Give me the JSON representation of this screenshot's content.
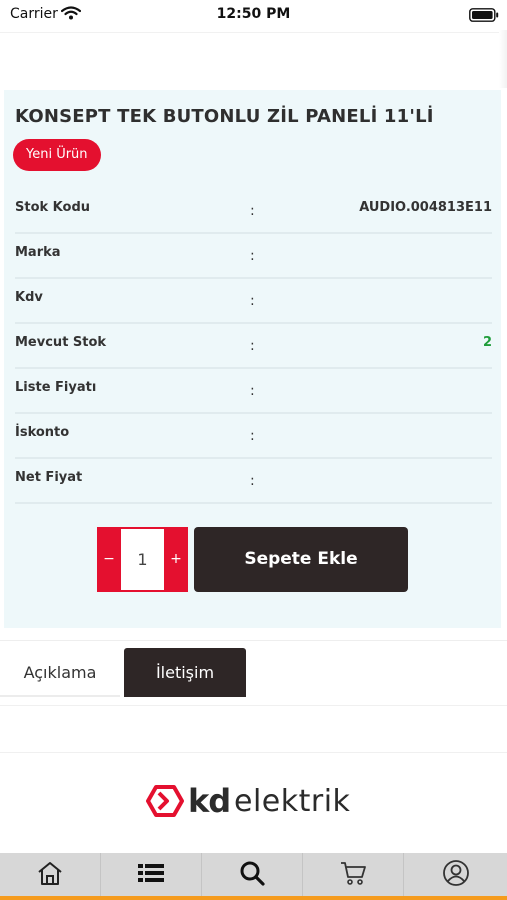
{
  "status_bar": {
    "carrier": "Carrier",
    "time": "12:50 PM"
  },
  "product": {
    "title": "KONSEPT TEK BUTONLU ZİL PANELİ 11'Lİ",
    "badge": "Yeni Ürün",
    "specs": [
      {
        "label": "Stok Kodu",
        "colon": ":",
        "value": ""
      },
      {
        "label": "Marka",
        "colon": ":",
        "value": ""
      },
      {
        "label": "Kdv",
        "colon": ":",
        "value": ""
      },
      {
        "label": "Mevcut Stok",
        "colon": ":",
        "value": ""
      },
      {
        "label": "Liste Fiyatı",
        "colon": ":",
        "value": ""
      },
      {
        "label": "İskonto",
        "colon": ":",
        "value": ""
      },
      {
        "label": "Net Fiyat",
        "colon": ":",
        "value": ""
      }
    ],
    "stock_code_value": "AUDIO.004813E11",
    "stock_qty_value": "2"
  },
  "cart": {
    "minus": "−",
    "quantity": "1",
    "plus": "+",
    "add_label": "Sepete Ekle"
  },
  "tabs": [
    {
      "label": "Açıklama",
      "active": false
    },
    {
      "label": "İletişim",
      "active": true
    }
  ],
  "logo": {
    "kd": "kd",
    "elektrik": "elektrik"
  },
  "tab_bar": {
    "items": [
      "home-icon",
      "list-icon",
      "search-icon",
      "cart-icon",
      "user-icon"
    ],
    "accent_color": "#f59b1d"
  },
  "colors": {
    "brand_red": "#e4102f",
    "dark": "#2e2626",
    "card_bg": "#eef8fa",
    "stock_green": "#1f9d3a"
  }
}
